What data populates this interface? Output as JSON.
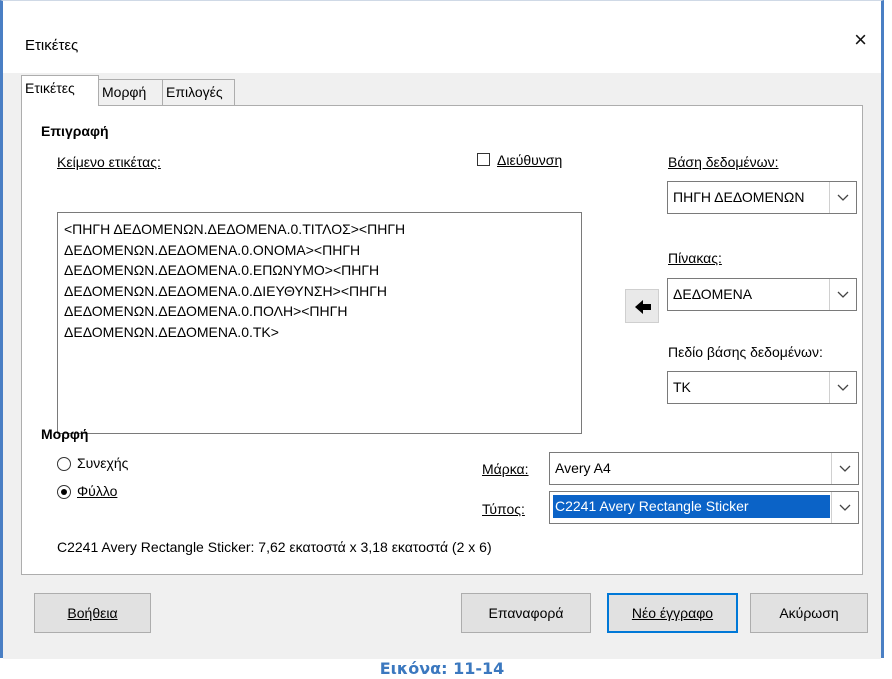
{
  "window": {
    "title": "Ετικέτες",
    "close_glyph": "×"
  },
  "tabs": [
    {
      "label": "Ετικέτες",
      "active": true
    },
    {
      "label": "Μορφή",
      "active": false
    },
    {
      "label": "Επιλογές",
      "active": false
    }
  ],
  "inscription": {
    "heading": "Επιγραφή",
    "label_text_caption": "Κείμενο ετικέτας:",
    "label_text_value": "<ΠΗΓΗ ΔΕΔΟΜΕΝΩΝ.ΔΕΔΟΜΕΝΑ.0.ΤΙΤΛΟΣ><ΠΗΓΗ\nΔΕΔΟΜΕΝΩΝ.ΔΕΔΟΜΕΝΑ.0.ΟΝΟΜΑ><ΠΗΓΗ\nΔΕΔΟΜΕΝΩΝ.ΔΕΔΟΜΕΝΑ.0.ΕΠΩΝΥΜΟ><ΠΗΓΗ\nΔΕΔΟΜΕΝΩΝ.ΔΕΔΟΜΕΝΑ.0.ΔΙΕΥΘΥΝΣΗ><ΠΗΓΗ\nΔΕΔΟΜΕΝΩΝ.ΔΕΔΟΜΕΝΑ.0.ΠΟΛΗ><ΠΗΓΗ\nΔΕΔΟΜΕΝΩΝ.ΔΕΔΟΜΕΝΑ.0.ΤΚ>",
    "address_checkbox_label": "Διεύθυνση",
    "address_checked": false,
    "database_label": "Βάση δεδομένων:",
    "database_value": "ΠΗΓΗ ΔΕΔΟΜΕΝΩΝ",
    "table_label": "Πίνακας:",
    "table_value": "ΔΕΔΟΜΕΝΑ",
    "field_label": "Πεδίο βάσης δεδομένων:",
    "field_value": "ΤΚ",
    "insert_arrow_icon": "arrow-left-icon"
  },
  "format": {
    "heading": "Μορφή",
    "continuous_label": "Συνεχής",
    "sheet_label": "Φύλλο",
    "selected": "sheet",
    "brand_label": "Μάρκα:",
    "brand_value": "Avery A4",
    "type_label": "Τύπος:",
    "type_value": "C2241 Avery Rectangle Sticker",
    "info": "C2241 Avery Rectangle Sticker: 7,62 εκατοστά x 3,18 εκατοστά (2 x 6)"
  },
  "buttons": {
    "help": "Βοήθεια",
    "reset": "Επαναφορά",
    "new_document": "Νέο έγγραφο",
    "cancel": "Ακύρωση"
  },
  "caption": "Εικόνα: 11-14",
  "colors": {
    "frame": "#4a7fc4",
    "selection": "#0b63c7",
    "default_button_border": "#0078d7",
    "caption": "#3b78bf"
  }
}
